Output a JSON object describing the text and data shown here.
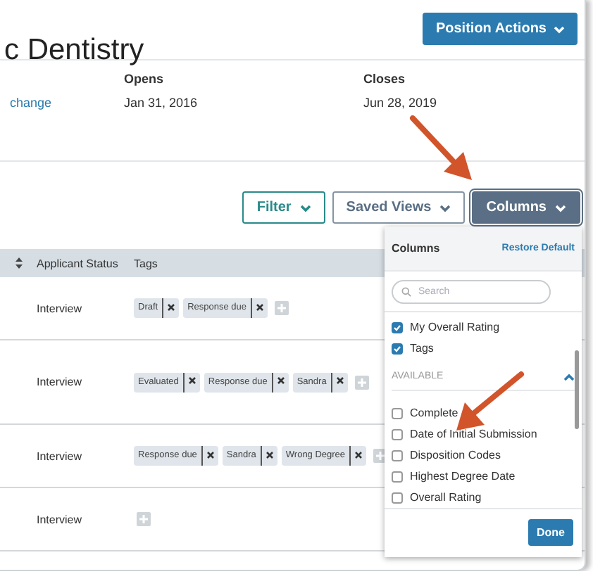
{
  "page": {
    "title": "c Dentistry",
    "primary_action": "Position Actions"
  },
  "details": {
    "link": "change",
    "fields": [
      {
        "label": "Opens",
        "value": "Jan 31, 2016"
      },
      {
        "label": "Closes",
        "value": "Jun 28, 2019"
      }
    ]
  },
  "toolbar": [
    {
      "label": "Filter",
      "kind": "filter"
    },
    {
      "label": "Saved Views",
      "kind": "views"
    },
    {
      "label": "Columns",
      "kind": "columns"
    }
  ],
  "table": {
    "columns": [
      "Applicant Status",
      "Tags"
    ],
    "rows": [
      {
        "status": "Interview",
        "tags": [
          "Draft",
          "Response due"
        ]
      },
      {
        "status": "Interview",
        "tags": [
          "Evaluated",
          "Response due",
          "Sandra"
        ]
      },
      {
        "status": "Interview",
        "tags": [
          "Response due",
          "Sandra",
          "Wrong Degree"
        ]
      },
      {
        "status": "Interview",
        "tags": []
      }
    ]
  },
  "columns_menu": {
    "title": "Columns",
    "action": "Restore Default",
    "search": {
      "placeholder": "Search"
    },
    "shown": [
      {
        "label": "My Overall Rating",
        "checked": true
      },
      {
        "label": "Tags",
        "checked": true
      }
    ],
    "section": "AVAILABLE",
    "expanded": true,
    "available": [
      {
        "label": "Complete",
        "checked": false
      },
      {
        "label": "Date of Initial Submission",
        "checked": false
      },
      {
        "label": "Disposition Codes",
        "checked": false
      },
      {
        "label": "Highest Degree Date",
        "checked": false
      },
      {
        "label": "Overall Rating",
        "checked": false
      }
    ],
    "done": "Done"
  }
}
